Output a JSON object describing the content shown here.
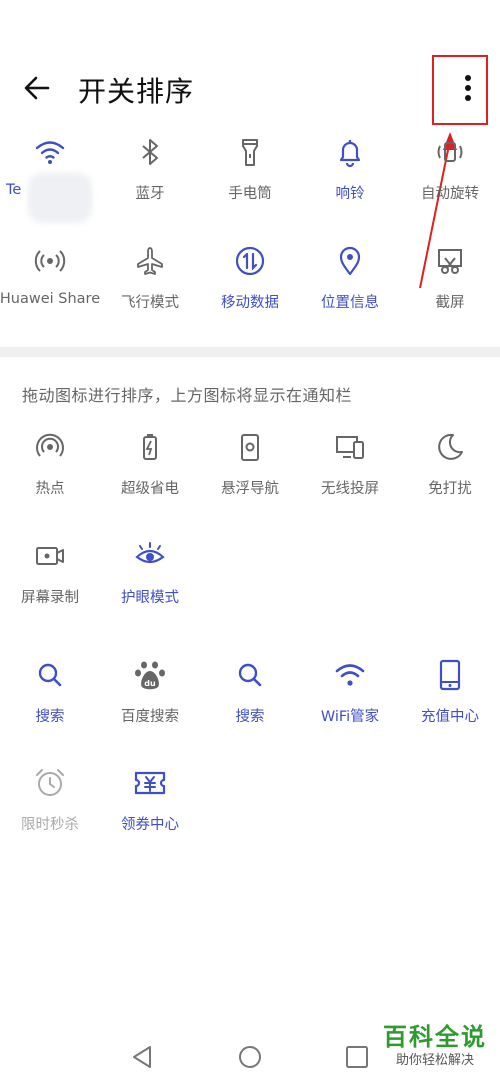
{
  "header": {
    "title": "开关排序"
  },
  "active_tiles": [
    {
      "label": "Te",
      "icon": "wifi-icon"
    },
    {
      "label": "蓝牙",
      "icon": "bluetooth-icon"
    },
    {
      "label": "手电筒",
      "icon": "flashlight-icon"
    },
    {
      "label": "响铃",
      "icon": "bell-icon"
    },
    {
      "label": "自动旋转",
      "icon": "auto-rotate-icon"
    },
    {
      "label": "Huawei Share",
      "icon": "huawei-share-icon"
    },
    {
      "label": "飞行模式",
      "icon": "airplane-icon"
    },
    {
      "label": "移动数据",
      "icon": "mobile-data-icon"
    },
    {
      "label": "位置信息",
      "icon": "location-icon"
    },
    {
      "label": "截屏",
      "icon": "screenshot-icon"
    }
  ],
  "hint_text": "拖动图标进行排序，上方图标将显示在通知栏",
  "more_tiles": [
    {
      "label": "热点",
      "icon": "hotspot-icon"
    },
    {
      "label": "超级省电",
      "icon": "battery-saver-icon"
    },
    {
      "label": "悬浮导航",
      "icon": "floating-nav-icon"
    },
    {
      "label": "无线投屏",
      "icon": "wireless-projection-icon"
    },
    {
      "label": "免打扰",
      "icon": "moon-icon"
    },
    {
      "label": "屏幕录制",
      "icon": "screen-record-icon"
    },
    {
      "label": "护眼模式",
      "icon": "eye-icon"
    }
  ],
  "app_tiles": [
    {
      "label": "搜索",
      "icon": "search-icon"
    },
    {
      "label": "百度搜索",
      "icon": "baidu-paw-icon"
    },
    {
      "label": "搜索",
      "icon": "search-icon"
    },
    {
      "label": "WiFi管家",
      "icon": "wifi-icon"
    },
    {
      "label": "充值中心",
      "icon": "phone-icon"
    },
    {
      "label": "限时秒杀",
      "icon": "alarm-clock-icon"
    },
    {
      "label": "领券中心",
      "icon": "coupon-icon"
    }
  ],
  "watermark": {
    "title": "百科全说",
    "subtitle": "助你轻松解决"
  },
  "colors": {
    "accent": "#3f4fc6",
    "inactive": "#666666",
    "highlight": "#e02020",
    "watermark": "#2f9a2f"
  }
}
